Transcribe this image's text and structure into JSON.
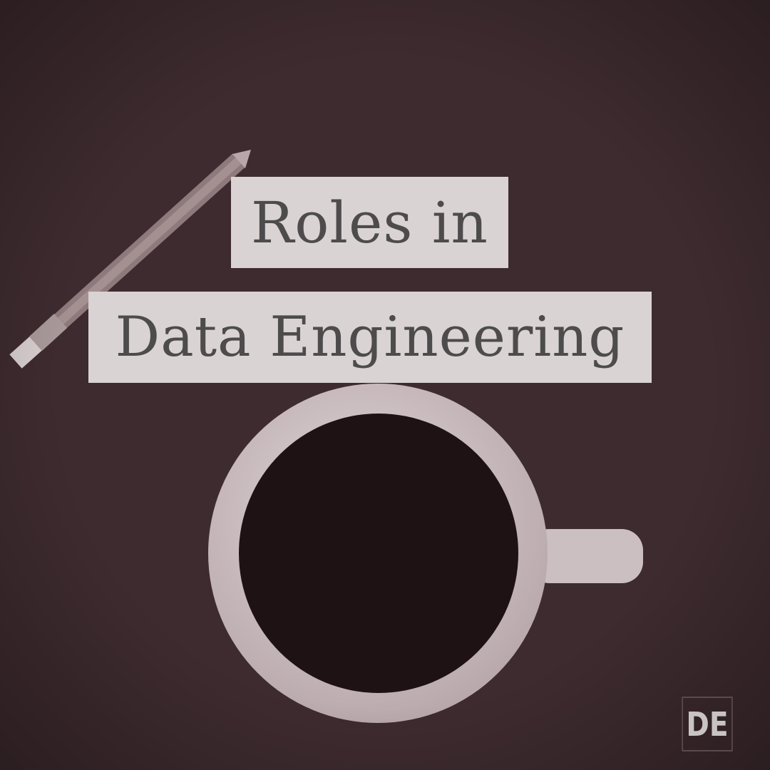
{
  "title": {
    "line1": "Roles in",
    "line2": "Data Engineering"
  },
  "logo": {
    "text": "DE"
  },
  "colors": {
    "background": "#3e2b2f",
    "title_box": "#d9d3d3",
    "title_text": "#4d4b4c",
    "mug": "#d2c5c7",
    "coffee": "#1e1214"
  }
}
